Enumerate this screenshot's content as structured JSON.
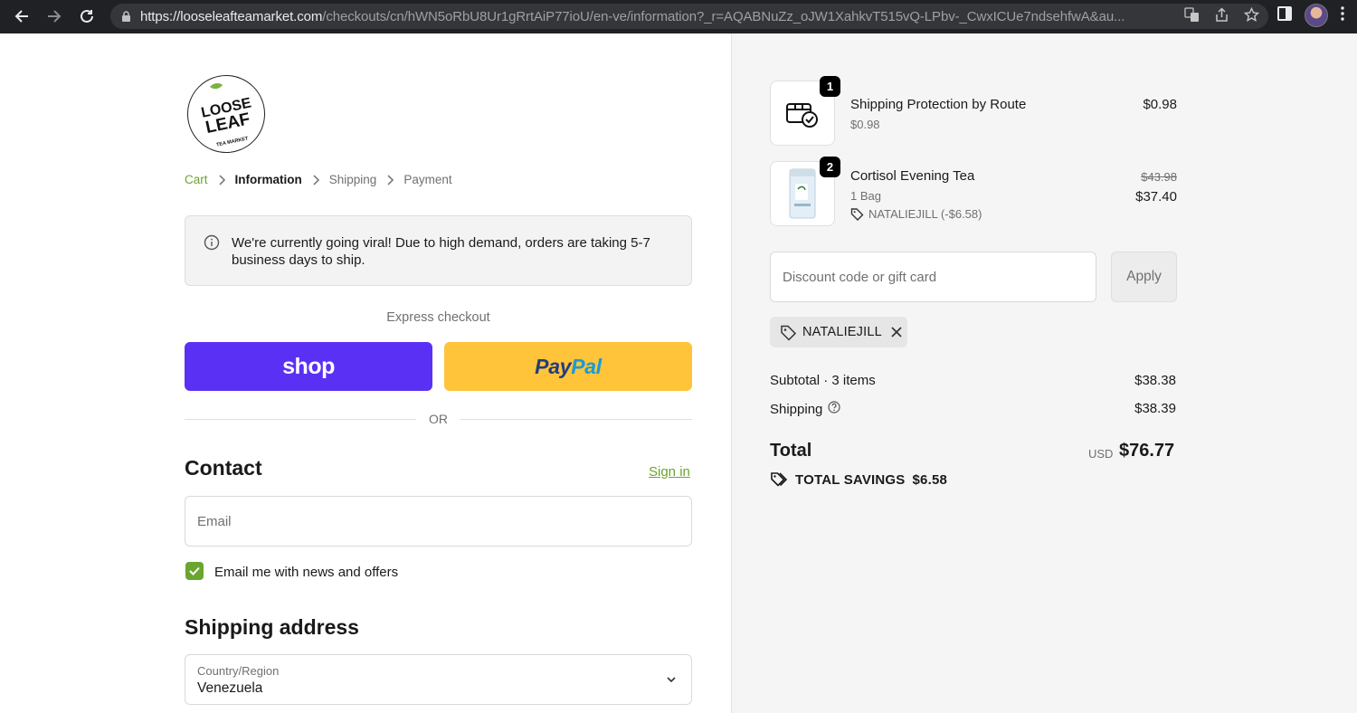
{
  "browser": {
    "url_host": "https://looseleafteamarket.com",
    "url_path": "/checkouts/cn/hWN5oRbU8Ur1gRrtAiP77ioU/en-ve/information?_r=AQABNuZz_oJW1XahkvT515vQ-LPbv-_CwxICUe7ndsehfwA&au..."
  },
  "logo": {
    "line1": "LOOSE",
    "line2": "LEAF",
    "line3": "TEA MARKET"
  },
  "breadcrumb": [
    "Cart",
    "Information",
    "Shipping",
    "Payment"
  ],
  "notice": "We're currently going viral! Due to high demand, orders are taking 5-7 business days to ship.",
  "express": {
    "label": "Express checkout",
    "shop": "shop",
    "paypal_pay": "Pay",
    "paypal_pal": "Pal"
  },
  "or_label": "OR",
  "contact": {
    "heading": "Contact",
    "sign_in": "Sign in",
    "email_placeholder": "Email",
    "newsletter_label": "Email me with news and offers",
    "newsletter_checked": true
  },
  "shipping_address": {
    "heading": "Shipping address",
    "country_label": "Country/Region",
    "country_value": "Venezuela"
  },
  "cart": {
    "items": [
      {
        "qty": "1",
        "name": "Shipping Protection by Route",
        "sub": "$0.98",
        "price": "$0.98"
      },
      {
        "qty": "2",
        "name": "Cortisol Evening Tea",
        "sub": "1 Bag",
        "discount": "NATALIEJILL (-$6.58)",
        "original_price": "$43.98",
        "price": "$37.40"
      }
    ],
    "discount_placeholder": "Discount code or gift card",
    "apply_label": "Apply",
    "applied_code": "NATALIEJILL",
    "subtotal_label": "Subtotal · 3 items",
    "subtotal_value": "$38.38",
    "shipping_label": "Shipping",
    "shipping_value": "$38.39",
    "total_label": "Total",
    "currency": "USD",
    "total_value": "$76.77",
    "savings_label": "TOTAL SAVINGS",
    "savings_value": "$6.58"
  },
  "colors": {
    "accent_green": "#6aa52f",
    "shop_purple": "#5a31f4",
    "paypal_yellow": "#ffc439"
  }
}
